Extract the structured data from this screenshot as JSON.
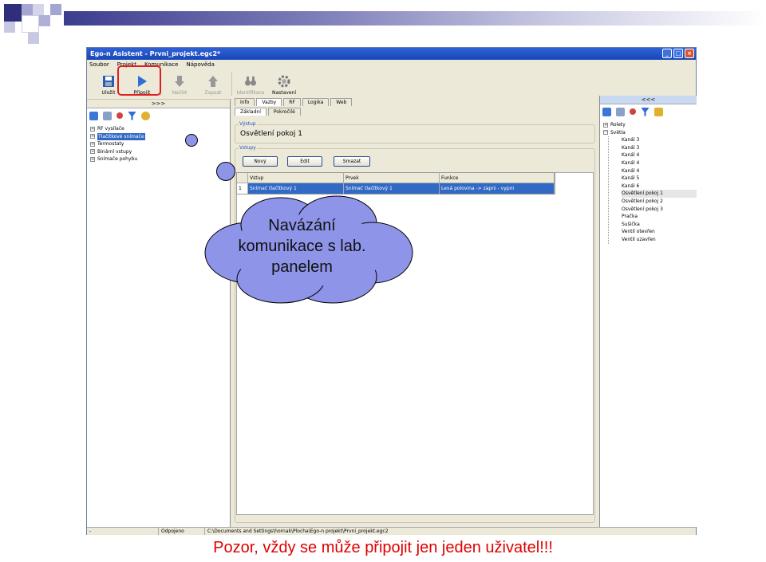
{
  "window": {
    "title": "Ego-n Asistent - Prvni_projekt.egc2*",
    "buttons": {
      "minimize": "_",
      "maximize": "□",
      "close": "×"
    }
  },
  "menu": [
    "Soubor",
    "Projekt",
    "Komunikace",
    "Nápověda"
  ],
  "toolbar": {
    "items": [
      {
        "label": "Uložit",
        "icon": "save-icon",
        "enabled": true
      },
      {
        "label": "Připojit",
        "icon": "play-icon",
        "enabled": true
      },
      {
        "label": "Načíst",
        "icon": "arrow-down-icon",
        "enabled": false
      },
      {
        "label": "Zapsat",
        "icon": "arrow-up-icon",
        "enabled": false
      },
      {
        "label": "Identifikace",
        "icon": "binoculars-icon",
        "enabled": false
      },
      {
        "label": "Nastavení",
        "icon": "gear-icon",
        "enabled": true
      }
    ]
  },
  "left_pane": {
    "header": ">>>",
    "tree": [
      "RF vysílače",
      "Tlačítkové snímače",
      "Termostaty",
      "Binární vstupy",
      "Snímače pohybu"
    ],
    "selected_index": 1
  },
  "center": {
    "tabs": [
      "Info",
      "Vazby",
      "RF",
      "Logika",
      "Web"
    ],
    "active_tab": "Vazby",
    "subtabs": [
      "Základní",
      "Pokročilé"
    ],
    "active_subtab": "Základní",
    "vystup_label": "Výstup",
    "vystup_value": "Osvětlení pokoj 1",
    "vstupy_label": "Vstupy",
    "buttons": {
      "new": "Nový",
      "edit": "Edit",
      "delete": "Smazat"
    },
    "grid": {
      "headers": [
        "",
        "Vstup",
        "Prvek",
        "Funkce"
      ],
      "rows": [
        [
          "1",
          "Snímač tlačítkový 1",
          "Snímač tlačítkový 1",
          "Levá polovina -> zapni - vypni"
        ]
      ]
    }
  },
  "right_pane": {
    "header": "<<<",
    "root_items": [
      "Rolety",
      "Světla"
    ],
    "children": [
      "Kanál 3",
      "Kanál 3",
      "Kanál 4",
      "Kanál 4",
      "Kanál 4",
      "Kanál 5",
      "Kanál 6",
      "Osvětlení pokoj 1",
      "Osvětlení pokoj 2",
      "Osvětlení pokoj 3",
      "Pračka",
      "Sušička",
      "Ventil otevřen",
      "Ventil uzavřen"
    ]
  },
  "statusbar": {
    "left": "-",
    "state": "Odpojeno",
    "path": "C:\\Documents and Settings\\hornak\\Plocha\\Ego-n projekt\\Prvni_projekt.egc2"
  },
  "callout": {
    "text": "Navázání komunikace s lab. panelem"
  },
  "caption": "Pozor, vždy se může připojit jen jeden uživatel!!!",
  "colors": {
    "accent": "#316ac5",
    "caption": "#e00000",
    "cloud": "#8e94e8",
    "highlight": "#e02020"
  }
}
